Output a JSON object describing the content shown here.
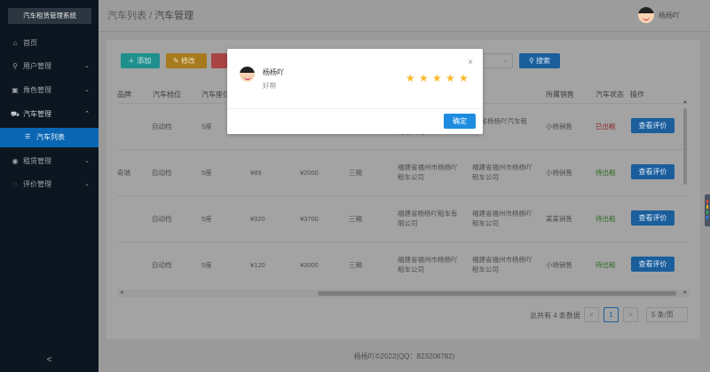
{
  "app": {
    "logo": "汽车租赁管理系统"
  },
  "sidebar": {
    "items": [
      {
        "label": "首页",
        "icon": "home-icon"
      },
      {
        "label": "用户管理",
        "icon": "user-icon"
      },
      {
        "label": "角色管理",
        "icon": "id-card-icon"
      },
      {
        "label": "汽车管理",
        "icon": "car-icon"
      },
      {
        "label": "租赁管理",
        "icon": "circle-icon"
      },
      {
        "label": "评价管理",
        "icon": "chat-icon"
      }
    ],
    "sub_item": {
      "label": "汽车列表"
    },
    "collapse": "<"
  },
  "header": {
    "breadcrumb_parent": "汽车列表",
    "breadcrumb_sep": "/",
    "breadcrumb_current": "汽车管理",
    "user_name": "杨杨吖"
  },
  "toolbar": {
    "add": "添加",
    "edit": "修改",
    "search": "搜索"
  },
  "table": {
    "headers": [
      "品牌",
      "汽车档位",
      "汽车座位",
      "",
      "",
      "",
      "",
      "",
      "所属销售",
      "汽车状态",
      "操作"
    ],
    "rows": [
      {
        "brand": "",
        "gear": "自动档",
        "seats": "5座",
        "price_day": "",
        "price_month": "",
        "area": "",
        "address1": "有限公司",
        "address2": "建省杨杨吖汽车租赁",
        "sales": "小杨销售",
        "status": "已出租",
        "status_type": "rented",
        "action": "查看评价"
      },
      {
        "brand": "奇瑞",
        "gear": "自动档",
        "seats": "5座",
        "price_day": "¥89",
        "price_month": "¥2000",
        "area": "三厢",
        "address1": "福建省福州市杨杨吖租车公司",
        "address2": "福建省福州市杨杨吖租车公司",
        "sales": "小杨销售",
        "status": "待出租",
        "status_type": "free",
        "action": "查看评价"
      },
      {
        "brand": "",
        "gear": "自动档",
        "seats": "5座",
        "price_day": "¥320",
        "price_month": "¥3700",
        "area": "三厢",
        "address1": "福建省杨杨吖租车有限公司",
        "address2": "福建省福州市杨杨吖租车公司",
        "sales": "某某销售",
        "status": "待出租",
        "status_type": "free",
        "action": "查看评价"
      },
      {
        "brand": "",
        "gear": "自动档",
        "seats": "5座",
        "price_day": "¥120",
        "price_month": "¥3000",
        "area": "三厢",
        "address1": "福建省福州市杨杨吖租车公司",
        "address2": "福建省福州市杨杨吖租车公司",
        "sales": "小杨销售",
        "status": "待出租",
        "status_type": "free",
        "action": "查看评价"
      }
    ]
  },
  "pagination": {
    "total": "总共有 4 条数据",
    "prev": "<",
    "page": "1",
    "next": ">",
    "size": "5 条/页"
  },
  "footer": "杨杨吖©2022(QQ：823208782)",
  "dialog": {
    "user_name": "杨杨吖",
    "comment": "好啊",
    "rating": 5,
    "close": "×",
    "confirm": "确定"
  },
  "colors": {
    "primary": "#1d8ce0",
    "star": "#f7ba2a",
    "sidebar_bg": "#0c1621",
    "active_nav": "#0a66b3"
  }
}
